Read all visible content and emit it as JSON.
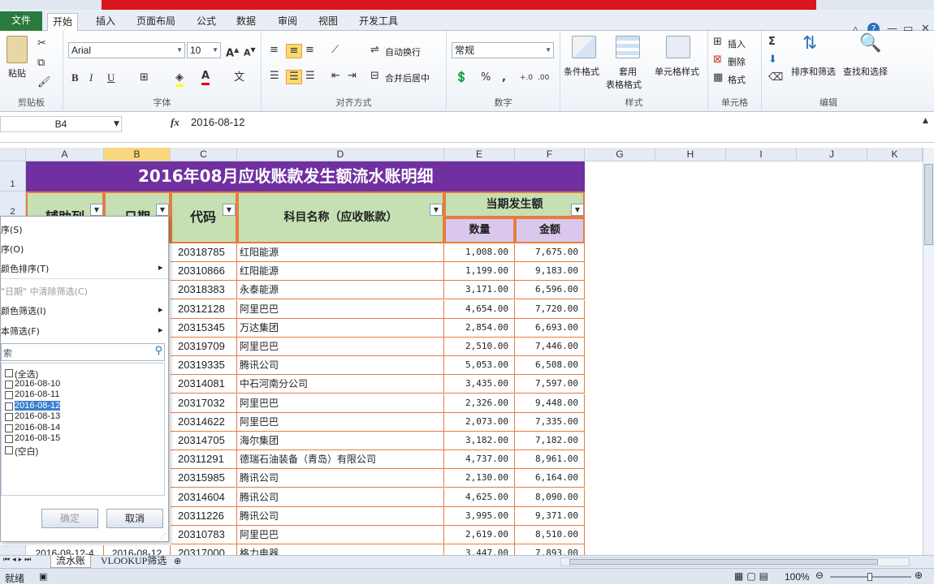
{
  "ribbon_tabs": [
    "文件",
    "开始",
    "插入",
    "页面布局",
    "公式",
    "数据",
    "审阅",
    "视图",
    "开发工具"
  ],
  "clipboard": {
    "paste": "粘贴",
    "group": "剪贴板"
  },
  "font": {
    "name": "Arial",
    "size": "10",
    "group": "字体"
  },
  "alignment": {
    "wrap": "自动换行",
    "merge": "合并后居中",
    "group": "对齐方式"
  },
  "number": {
    "format": "常规",
    "group": "数字"
  },
  "styles": {
    "conditional": "条件格式",
    "table_line1": "套用",
    "table_line2": "表格格式",
    "cell_styles": "单元格样式",
    "group": "样式"
  },
  "cells": {
    "insert": "插入",
    "delete": "删除",
    "format": "格式",
    "group": "单元格"
  },
  "editing": {
    "sort": "排序和筛选",
    "find": "查找和选择",
    "group": "编辑"
  },
  "formula_bar": {
    "name_box": "B4",
    "fx": "fx",
    "content": "2016-08-12"
  },
  "columns": [
    "A",
    "B",
    "C",
    "D",
    "E",
    "F",
    "G",
    "H",
    "I",
    "J",
    "K"
  ],
  "sheet": {
    "title": "2016年08月应收账款发生额流水账明细",
    "headers": {
      "aux": "辅助列",
      "date": "日期",
      "code": "代码",
      "subject": "科目名称（应收账款）",
      "period": "当期发生额",
      "qty": "数量",
      "amount": "金额"
    },
    "rows": [
      {
        "code": "20318785",
        "name": "红阳能源",
        "qty": "1,008.00",
        "amount": "7,675.00"
      },
      {
        "code": "20310866",
        "name": "红阳能源",
        "qty": "1,199.00",
        "amount": "9,183.00"
      },
      {
        "code": "20318383",
        "name": "永泰能源",
        "qty": "3,171.00",
        "amount": "6,596.00"
      },
      {
        "code": "20312128",
        "name": "阿里巴巴",
        "qty": "4,654.00",
        "amount": "7,720.00"
      },
      {
        "code": "20315345",
        "name": "万达集团",
        "qty": "2,854.00",
        "amount": "6,693.00"
      },
      {
        "code": "20319709",
        "name": "阿里巴巴",
        "qty": "2,510.00",
        "amount": "7,446.00"
      },
      {
        "code": "20319335",
        "name": "腾讯公司",
        "qty": "5,053.00",
        "amount": "6,508.00"
      },
      {
        "code": "20314081",
        "name": "中石河南分公司",
        "qty": "3,435.00",
        "amount": "7,597.00"
      },
      {
        "code": "20317032",
        "name": "阿里巴巴",
        "qty": "2,326.00",
        "amount": "9,448.00"
      },
      {
        "code": "20314622",
        "name": "阿里巴巴",
        "qty": "2,073.00",
        "amount": "7,335.00"
      },
      {
        "code": "20314705",
        "name": "海尔集团",
        "qty": "3,182.00",
        "amount": "7,182.00"
      },
      {
        "code": "20311291",
        "name": "德瑞石油装备（青岛）有限公司",
        "qty": "4,737.00",
        "amount": "8,961.00"
      },
      {
        "code": "20315985",
        "name": "腾讯公司",
        "qty": "2,130.00",
        "amount": "6,164.00"
      },
      {
        "code": "20314604",
        "name": "腾讯公司",
        "qty": "4,625.00",
        "amount": "8,090.00"
      },
      {
        "code": "20311226",
        "name": "腾讯公司",
        "qty": "3,995.00",
        "amount": "9,371.00"
      },
      {
        "code": "20310783",
        "name": "阿里巴巴",
        "qty": "2,619.00",
        "amount": "8,510.00"
      },
      {
        "code": "20317000",
        "name": "格力电器",
        "qty": "3,447.00",
        "amount": "7,893.00"
      }
    ],
    "bottom_row": {
      "aux": "2016-08-12-4",
      "date": "2016-08-12"
    }
  },
  "filter_menu": {
    "sort_asc": "序(S)",
    "sort_desc": "序(O)",
    "sort_color": "颜色排序(T)",
    "clear": "\"日期\" 中清除筛选(C)",
    "color_filter": "颜色筛选(I)",
    "text_filter": "本筛选(F)",
    "search_placeholder": "索",
    "items": [
      "(全选)",
      "2016-08-10",
      "2016-08-11",
      "2016-08-12",
      "2016-08-13",
      "2016-08-14",
      "2016-08-15",
      "(空白)"
    ],
    "ok": "确定",
    "cancel": "取消"
  },
  "sheet_tabs": [
    "流水账",
    "VLOOKUP筛选"
  ],
  "status": {
    "ready": "就绪",
    "zoom": "100%"
  },
  "row_labels": [
    "1",
    "2"
  ]
}
